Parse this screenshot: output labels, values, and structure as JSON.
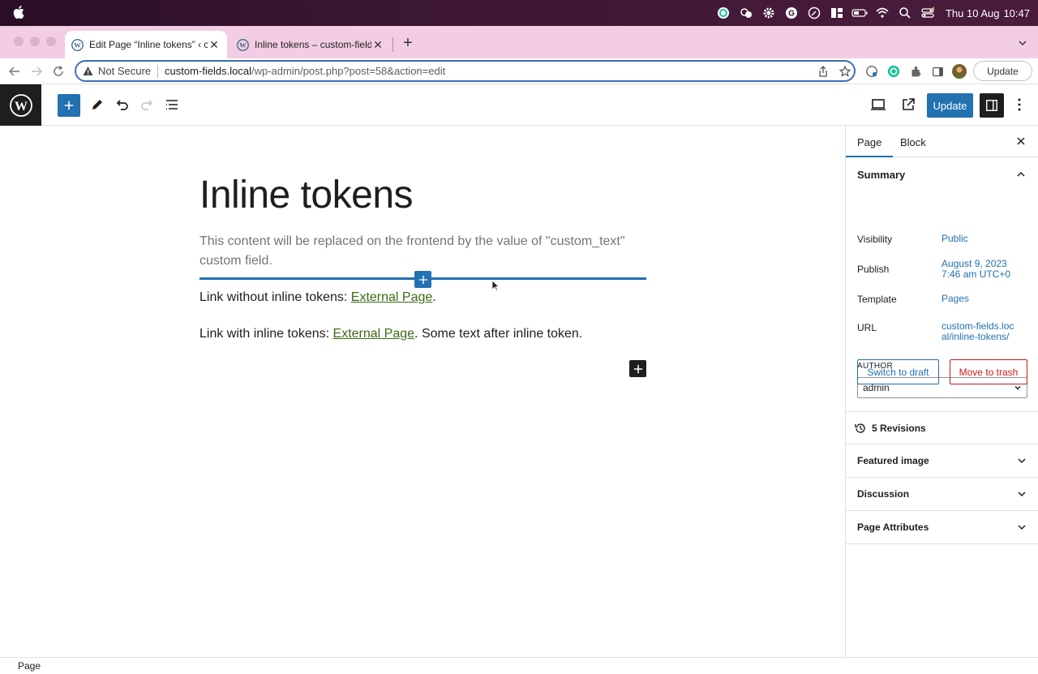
{
  "system": {
    "clock_day": "Thu 10 Aug",
    "clock_time": "10:47"
  },
  "browser": {
    "tabs": [
      {
        "title": "Edit Page “Inline tokens” ‹ custom-fields",
        "active": true
      },
      {
        "title": "Inline tokens – custom-fields",
        "active": false
      }
    ],
    "address": {
      "security_label": "Not Secure",
      "host": "custom-fields.local",
      "path": "/wp-admin/post.php?post=58&action=edit"
    },
    "update_label": "Update"
  },
  "editor": {
    "update_label": "Update",
    "post_title": "Inline tokens",
    "placeholder_paragraph": "This content will be replaced on the frontend by the value of \"custom_text\" custom field.",
    "line1": {
      "prefix": "Link without inline tokens: ",
      "link": "External Page",
      "suffix": "."
    },
    "line2": {
      "prefix": "Link with inline tokens: ",
      "link": "External Page",
      "suffix": ". Some text after inline token."
    }
  },
  "sidebar": {
    "tabs": [
      "Page",
      "Block"
    ],
    "summary_title": "Summary",
    "rows": {
      "visibility_label": "Visibility",
      "visibility_value": "Public",
      "publish_label": "Publish",
      "publish_value": "August 9, 2023 7:46 am UTC+0",
      "template_label": "Template",
      "template_value": "Pages",
      "url_label": "URL",
      "url_value": "custom-fields.local/inline-tokens/"
    },
    "author_label": "AUTHOR",
    "author_value": "admin",
    "switch_draft_label": "Switch to draft",
    "trash_label": "Move to trash",
    "revisions_label": "5 Revisions",
    "panels": [
      "Featured image",
      "Discussion",
      "Page Attributes"
    ]
  },
  "footer": {
    "breadcrumb": "Page"
  }
}
